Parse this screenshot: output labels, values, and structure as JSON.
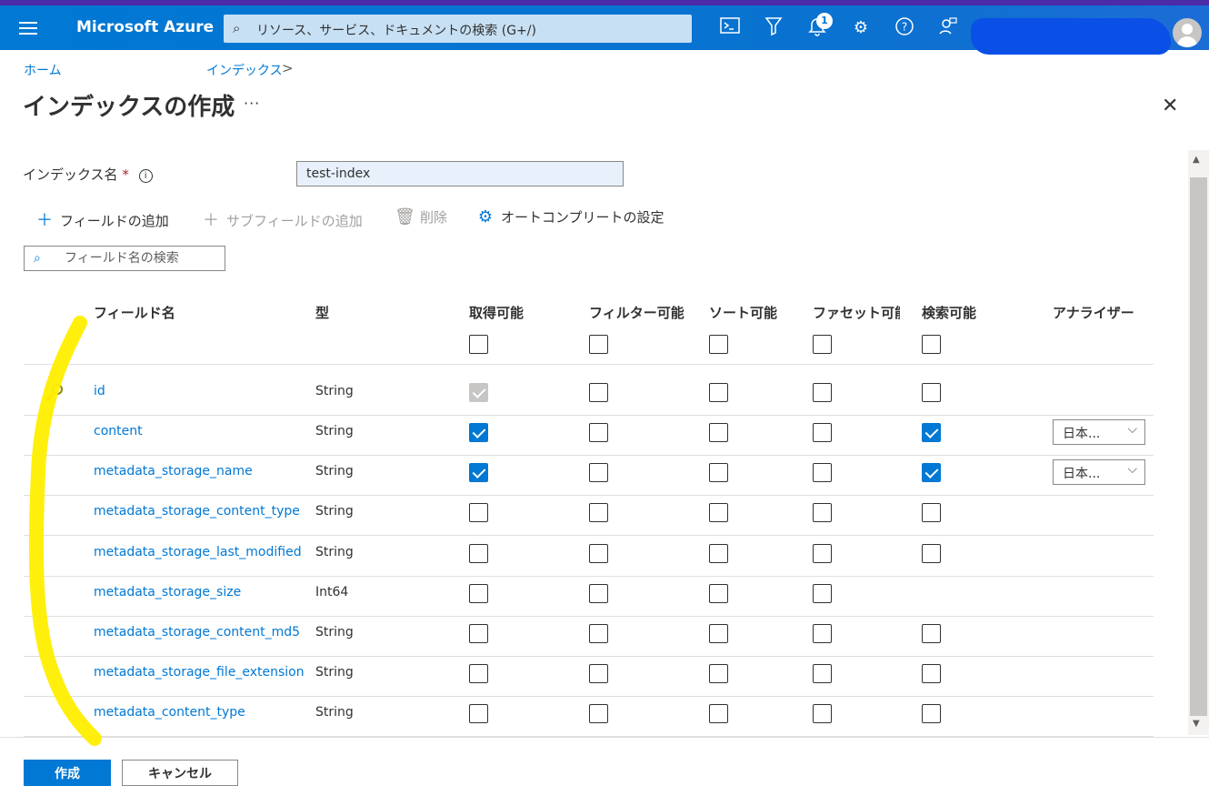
{
  "topbar": {
    "brand": "Microsoft Azure",
    "search_placeholder": "リソース、サービス、ドキュメントの検索 (G+/)",
    "notification_count": "1",
    "icons": [
      "cloud-shell-icon",
      "directory-filter-icon",
      "notifications-icon",
      "settings-icon",
      "help-icon",
      "feedback-icon"
    ]
  },
  "breadcrumb": {
    "home": "ホーム",
    "indexes": "インデックス",
    "separator": ">"
  },
  "page": {
    "title": "インデックスの作成",
    "more": "···",
    "close": "✕"
  },
  "form": {
    "index_name_label": "インデックス名",
    "required_marker": "*",
    "info_icon": "i",
    "index_name_value": "test-index"
  },
  "commands": {
    "add_field": "フィールドの追加",
    "add_subfield": "サブフィールドの追加",
    "delete": "削除",
    "autocomplete": "オートコンプリートの設定"
  },
  "field_search": {
    "placeholder": "フィールド名の検索"
  },
  "table": {
    "headers": {
      "field_name": "フィールド名",
      "type": "型",
      "retrievable": "取得可能",
      "filterable": "フィルター可能",
      "sortable": "ソート可能",
      "facetable": "ファセット可能",
      "searchable": "検索可能",
      "analyzer": "アナライザー"
    },
    "rows": [
      {
        "name": "id",
        "type": "String",
        "key": true,
        "retrievable": "disabled",
        "filterable": false,
        "sortable": false,
        "facetable": false,
        "searchable": false,
        "analyzer": ""
      },
      {
        "name": "content",
        "type": "String",
        "key": false,
        "retrievable": true,
        "filterable": false,
        "sortable": false,
        "facetable": false,
        "searchable": true,
        "analyzer": "日本..."
      },
      {
        "name": "metadata_storage_name",
        "type": "String",
        "key": false,
        "retrievable": true,
        "filterable": false,
        "sortable": false,
        "facetable": false,
        "searchable": true,
        "analyzer": "日本..."
      },
      {
        "name": "metadata_storage_content_type",
        "type": "String",
        "key": false,
        "retrievable": false,
        "filterable": false,
        "sortable": false,
        "facetable": false,
        "searchable": false,
        "analyzer": ""
      },
      {
        "name": "metadata_storage_last_modified",
        "type": "String",
        "key": false,
        "retrievable": false,
        "filterable": false,
        "sortable": false,
        "facetable": false,
        "searchable": false,
        "analyzer": ""
      },
      {
        "name": "metadata_storage_size",
        "type": "Int64",
        "key": false,
        "retrievable": false,
        "filterable": false,
        "sortable": false,
        "facetable": false,
        "searchable": null,
        "analyzer": ""
      },
      {
        "name": "metadata_storage_content_md5",
        "type": "String",
        "key": false,
        "retrievable": false,
        "filterable": false,
        "sortable": false,
        "facetable": false,
        "searchable": false,
        "analyzer": ""
      },
      {
        "name": "metadata_storage_file_extension",
        "type": "String",
        "key": false,
        "retrievable": false,
        "filterable": false,
        "sortable": false,
        "facetable": false,
        "searchable": false,
        "analyzer": ""
      },
      {
        "name": "metadata_content_type",
        "type": "String",
        "key": false,
        "retrievable": false,
        "filterable": false,
        "sortable": false,
        "facetable": false,
        "searchable": false,
        "analyzer": ""
      }
    ]
  },
  "footer": {
    "create": "作成",
    "cancel": "キャンセル"
  },
  "colors": {
    "accent": "#0078d4",
    "highlight": "#ffee00"
  }
}
